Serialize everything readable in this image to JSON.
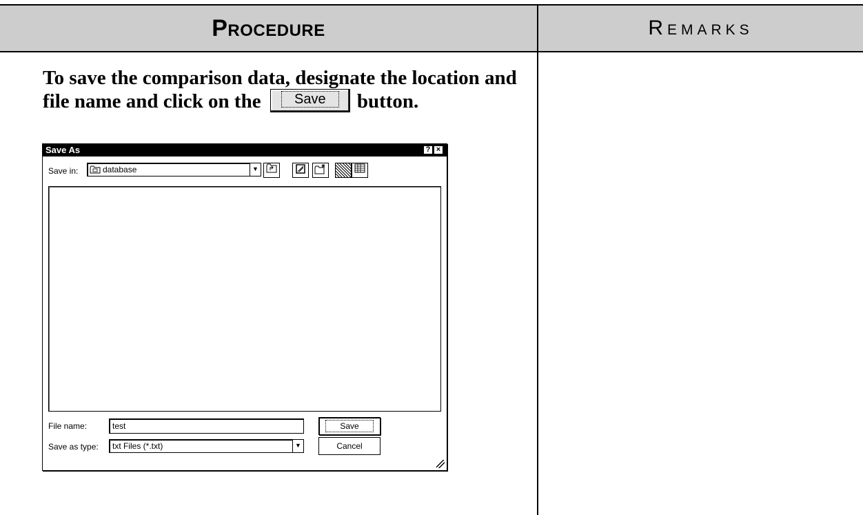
{
  "header": {
    "procedure_label": "Procedure",
    "remarks_label": "Remarks"
  },
  "instruction": {
    "text_before": "To save the comparison data, designate the location and file name and click on the",
    "button_label": "Save",
    "text_after": "button."
  },
  "dialog": {
    "title": "Save As",
    "help_btn": "?",
    "close_btn": "×",
    "save_in_label": "Save in:",
    "save_in_value": "database",
    "file_name_label": "File name:",
    "file_name_value": "test",
    "save_as_type_label": "Save as type:",
    "save_as_type_value": "txt Files (*.txt)",
    "save_button": "Save",
    "cancel_button": "Cancel",
    "icons": {
      "folder": "folder-icon",
      "up_folder": "up-folder-icon",
      "desktop": "desktop-icon",
      "new_folder": "new-folder-icon",
      "list_view": "list-view-icon",
      "details_view": "details-view-icon",
      "dropdown": "chevron-down-icon"
    }
  }
}
